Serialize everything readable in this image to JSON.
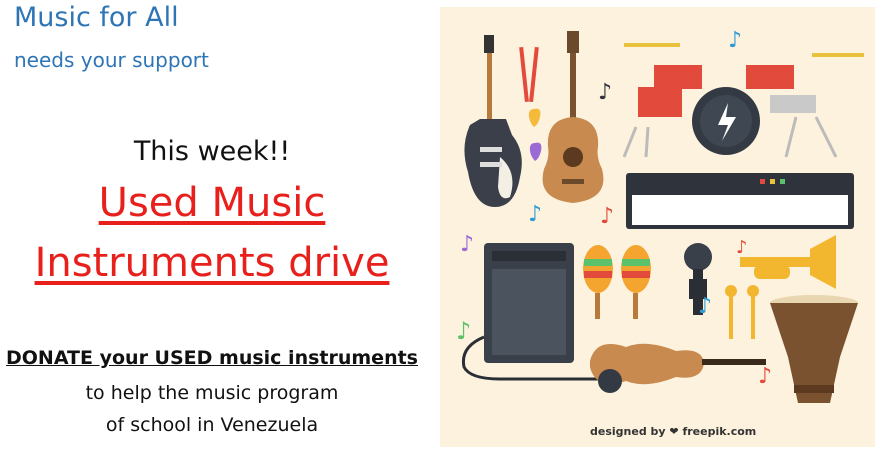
{
  "header": {
    "org_name": "Music for All",
    "tagline": "needs your support"
  },
  "announcement": {
    "week": "This week!!",
    "drive_line1": "Used Music",
    "drive_line2": "Instruments drive"
  },
  "call_to_action": {
    "donate": "DONATE your USED music instruments",
    "help_line1": "to help the music program",
    "help_line2": "of school in Venezuela"
  },
  "image": {
    "credit": "designed by ❤ freepik.com"
  },
  "colors": {
    "title_blue": "#2e75b6",
    "drive_red": "#e8201c",
    "poster_bg": "#fdf2dd"
  }
}
